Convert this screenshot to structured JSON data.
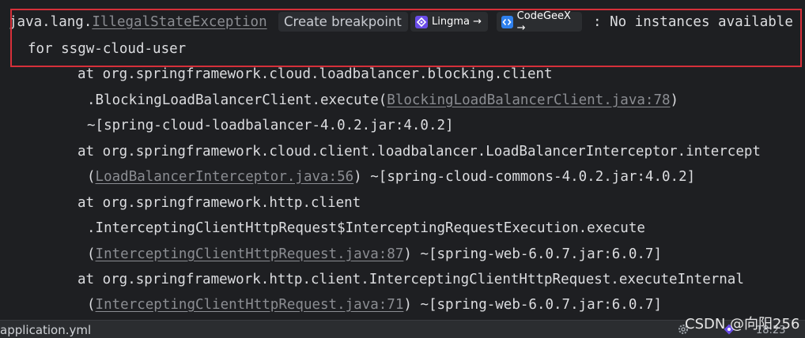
{
  "console": {
    "exception_prefix": "java.lang.",
    "exception_link": "IllegalStateException",
    "exception_suffix": ": No instances available",
    "exception_cont": "for ssgw-cloud-user",
    "inlay": {
      "breakpoint_label": "Create breakpoint",
      "lingma_label": "Lingma →",
      "codegeex_label": "CodeGeeX →"
    },
    "lines": [
      {
        "pre": "at org.springframework.cloud.loadbalancer.blocking.client",
        "link": "",
        "post": ""
      },
      {
        "pre": ".BlockingLoadBalancerClient.execute(",
        "link": "BlockingLoadBalancerClient.java:78",
        "post": ")"
      },
      {
        "pre": "~[spring-cloud-loadbalancer-4.0.2.jar:4.0.2]",
        "link": "",
        "post": ""
      },
      {
        "pre": "at org.springframework.cloud.client.loadbalancer.LoadBalancerInterceptor.intercept",
        "link": "",
        "post": ""
      },
      {
        "pre": "(",
        "link": "LoadBalancerInterceptor.java:56",
        "post": ") ~[spring-cloud-commons-4.0.2.jar:4.0.2]"
      },
      {
        "pre": "at org.springframework.http.client",
        "link": "",
        "post": ""
      },
      {
        "pre": ".InterceptingClientHttpRequest$InterceptingRequestExecution.execute",
        "link": "",
        "post": ""
      },
      {
        "pre": "(",
        "link": "InterceptingClientHttpRequest.java:87",
        "post": ") ~[spring-web-6.0.7.jar:6.0.7]"
      },
      {
        "pre": "at org.springframework.http.client.InterceptingClientHttpRequest.executeInternal",
        "link": "",
        "post": ""
      },
      {
        "pre": "(",
        "link": "InterceptingClientHttpRequest.java:71",
        "post": ") ~[spring-web-6.0.7.jar:6.0.7]"
      }
    ]
  },
  "statusbar": {
    "file_tab": "application.yml",
    "watermark": "CSDN @向阳256",
    "time": "18:23"
  },
  "colors": {
    "highlight_border": "#d6303a",
    "lingma_brand": "#6a4ce8",
    "codegeex_brand": "#2f80ed"
  },
  "icons": [
    "lingma-icon",
    "codegeex-icon",
    "gear-icon",
    "lingma-status-icon"
  ]
}
